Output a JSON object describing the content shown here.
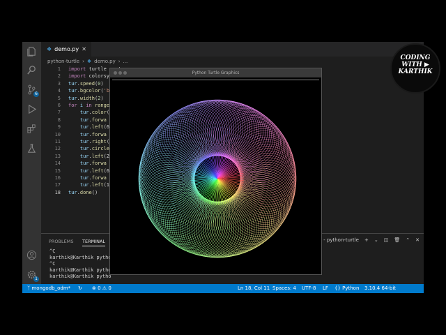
{
  "editor": {
    "tab_label": "demo.py",
    "breadcrumb": [
      "python-turtle",
      "demo.py",
      "..."
    ],
    "lines": [
      {
        "n": "1",
        "segs": [
          {
            "c": "kw",
            "t": "import"
          },
          {
            "c": "",
            "t": " turtle as tur"
          }
        ]
      },
      {
        "n": "2",
        "segs": [
          {
            "c": "kw",
            "t": "import"
          },
          {
            "c": "",
            "t": " colorsys"
          }
        ]
      },
      {
        "n": "3",
        "segs": [
          {
            "c": "var",
            "t": "tur"
          },
          {
            "c": "",
            "t": "."
          },
          {
            "c": "fn",
            "t": "speed"
          },
          {
            "c": "",
            "t": "("
          },
          {
            "c": "num",
            "t": "0"
          },
          {
            "c": "",
            "t": ")"
          }
        ]
      },
      {
        "n": "4",
        "segs": [
          {
            "c": "var",
            "t": "tur"
          },
          {
            "c": "",
            "t": "."
          },
          {
            "c": "fn",
            "t": "bgcolor"
          },
          {
            "c": "",
            "t": "("
          },
          {
            "c": "str",
            "t": "'b"
          }
        ]
      },
      {
        "n": "5",
        "segs": [
          {
            "c": "var",
            "t": "tur"
          },
          {
            "c": "",
            "t": "."
          },
          {
            "c": "fn",
            "t": "width"
          },
          {
            "c": "",
            "t": "("
          },
          {
            "c": "num",
            "t": "2"
          },
          {
            "c": "",
            "t": ")"
          }
        ]
      },
      {
        "n": "6",
        "segs": [
          {
            "c": "kw",
            "t": "for"
          },
          {
            "c": "",
            "t": " "
          },
          {
            "c": "var",
            "t": "i"
          },
          {
            "c": "",
            "t": " "
          },
          {
            "c": "kw",
            "t": "in"
          },
          {
            "c": "",
            "t": " "
          },
          {
            "c": "fn",
            "t": "range"
          }
        ]
      },
      {
        "n": "7",
        "segs": [
          {
            "c": "",
            "t": "    "
          },
          {
            "c": "var",
            "t": "tur"
          },
          {
            "c": "",
            "t": "."
          },
          {
            "c": "fn",
            "t": "color"
          },
          {
            "c": "",
            "t": "("
          }
        ]
      },
      {
        "n": "8",
        "segs": [
          {
            "c": "",
            "t": "    "
          },
          {
            "c": "var",
            "t": "tur"
          },
          {
            "c": "",
            "t": "."
          },
          {
            "c": "fn",
            "t": "forwa"
          }
        ]
      },
      {
        "n": "9",
        "segs": [
          {
            "c": "",
            "t": "    "
          },
          {
            "c": "var",
            "t": "tur"
          },
          {
            "c": "",
            "t": "."
          },
          {
            "c": "fn",
            "t": "left"
          },
          {
            "c": "",
            "t": "(6"
          }
        ]
      },
      {
        "n": "10",
        "segs": [
          {
            "c": "",
            "t": "    "
          },
          {
            "c": "var",
            "t": "tur"
          },
          {
            "c": "",
            "t": "."
          },
          {
            "c": "fn",
            "t": "forwa"
          }
        ]
      },
      {
        "n": "11",
        "segs": [
          {
            "c": "",
            "t": "    "
          },
          {
            "c": "var",
            "t": "tur"
          },
          {
            "c": "",
            "t": "."
          },
          {
            "c": "fn",
            "t": "right"
          },
          {
            "c": "",
            "t": "("
          }
        ]
      },
      {
        "n": "12",
        "segs": [
          {
            "c": "",
            "t": "    "
          },
          {
            "c": "var",
            "t": "tur"
          },
          {
            "c": "",
            "t": "."
          },
          {
            "c": "fn",
            "t": "circle"
          }
        ]
      },
      {
        "n": "13",
        "segs": [
          {
            "c": "",
            "t": "    "
          },
          {
            "c": "var",
            "t": "tur"
          },
          {
            "c": "",
            "t": "."
          },
          {
            "c": "fn",
            "t": "left"
          },
          {
            "c": "",
            "t": "(2"
          }
        ]
      },
      {
        "n": "14",
        "segs": [
          {
            "c": "",
            "t": "    "
          },
          {
            "c": "var",
            "t": "tur"
          },
          {
            "c": "",
            "t": "."
          },
          {
            "c": "fn",
            "t": "forwa"
          }
        ]
      },
      {
        "n": "15",
        "segs": [
          {
            "c": "",
            "t": "    "
          },
          {
            "c": "var",
            "t": "tur"
          },
          {
            "c": "",
            "t": "."
          },
          {
            "c": "fn",
            "t": "left"
          },
          {
            "c": "",
            "t": "(6"
          }
        ]
      },
      {
        "n": "16",
        "segs": [
          {
            "c": "",
            "t": "    "
          },
          {
            "c": "var",
            "t": "tur"
          },
          {
            "c": "",
            "t": "."
          },
          {
            "c": "fn",
            "t": "forwa"
          }
        ]
      },
      {
        "n": "17",
        "segs": [
          {
            "c": "",
            "t": "    "
          },
          {
            "c": "var",
            "t": "tur"
          },
          {
            "c": "",
            "t": "."
          },
          {
            "c": "fn",
            "t": "left"
          },
          {
            "c": "",
            "t": "(1"
          }
        ]
      },
      {
        "n": "18",
        "segs": [
          {
            "c": "var",
            "t": "tur"
          },
          {
            "c": "",
            "t": "."
          },
          {
            "c": "fn",
            "t": "done"
          },
          {
            "c": "",
            "t": "()"
          }
        ]
      }
    ],
    "active_line": "18"
  },
  "panel": {
    "tabs": [
      "PROBLEMS",
      "TERMINAL"
    ],
    "active_tab": "TERMINAL",
    "terminal_selector": "hon - python-turtle",
    "terminal_lines": [
      "^C",
      "karthik@Karthik pytho",
      "^C",
      "karthik@Karthik pytho",
      "karthik@Karthik pytho"
    ]
  },
  "turtle_window": {
    "title": "Python Turtle Graphics"
  },
  "logo": {
    "line1": "CODING",
    "line2": "WITH",
    "line3": "KARTHIK"
  },
  "status_bar": {
    "branch": "mongodb_odm*",
    "errors": "0",
    "warnings": "0",
    "position": "Ln 18, Col 11",
    "spaces": "Spaces: 4",
    "encoding": "UTF-8",
    "eol": "LF",
    "language": "Python",
    "interpreter": "3.10.4 64-bit"
  },
  "activity_bar": {
    "icons": [
      "explorer-icon",
      "search-icon",
      "source-control-icon",
      "run-debug-icon",
      "extensions-icon",
      "testing-icon",
      "account-icon",
      "settings-gear-icon"
    ],
    "source_control_badge": "6",
    "settings_badge": "1"
  }
}
